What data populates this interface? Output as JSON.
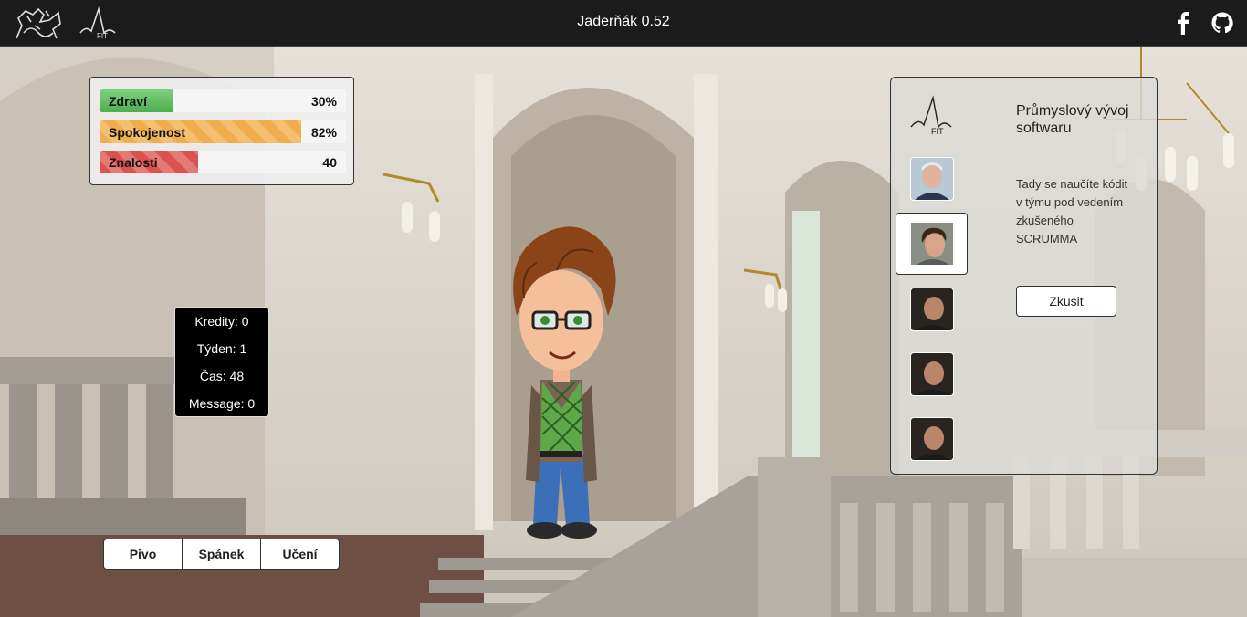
{
  "header": {
    "title": "Jaderňák 0.52",
    "logo_left": "ctu-lion-logo",
    "logo_right": "fit-logo",
    "facebook": "facebook-icon",
    "github": "github-icon"
  },
  "stats": [
    {
      "label": "Zdraví",
      "value": "30%",
      "fraction": 0.3,
      "color": "#5cb85c"
    },
    {
      "label": "Spokojenost",
      "value": "82%",
      "fraction": 0.82,
      "color": "#f0ad4e"
    },
    {
      "label": "Znalosti",
      "value": "40",
      "fraction": 0.4,
      "color": "#d9534f"
    }
  ],
  "info": {
    "credits": "Kredity: 0",
    "week": "Týden: 1",
    "time": "Čas: 48",
    "message": "Message: 0"
  },
  "actions": [
    "Pivo",
    "Spánek",
    "Učení"
  ],
  "subject": {
    "title": "Průmyslový vývoj softwaru",
    "description": "Tady se naučíte kódit v týmu pod vedením zkušeného SCRUMMA",
    "button": "Zkusit",
    "teachers": [
      "teacher-white-hair",
      "teacher-curly-hair",
      "teacher-bald",
      "teacher-bald",
      "teacher-bald"
    ],
    "selected_teacher": 1
  }
}
